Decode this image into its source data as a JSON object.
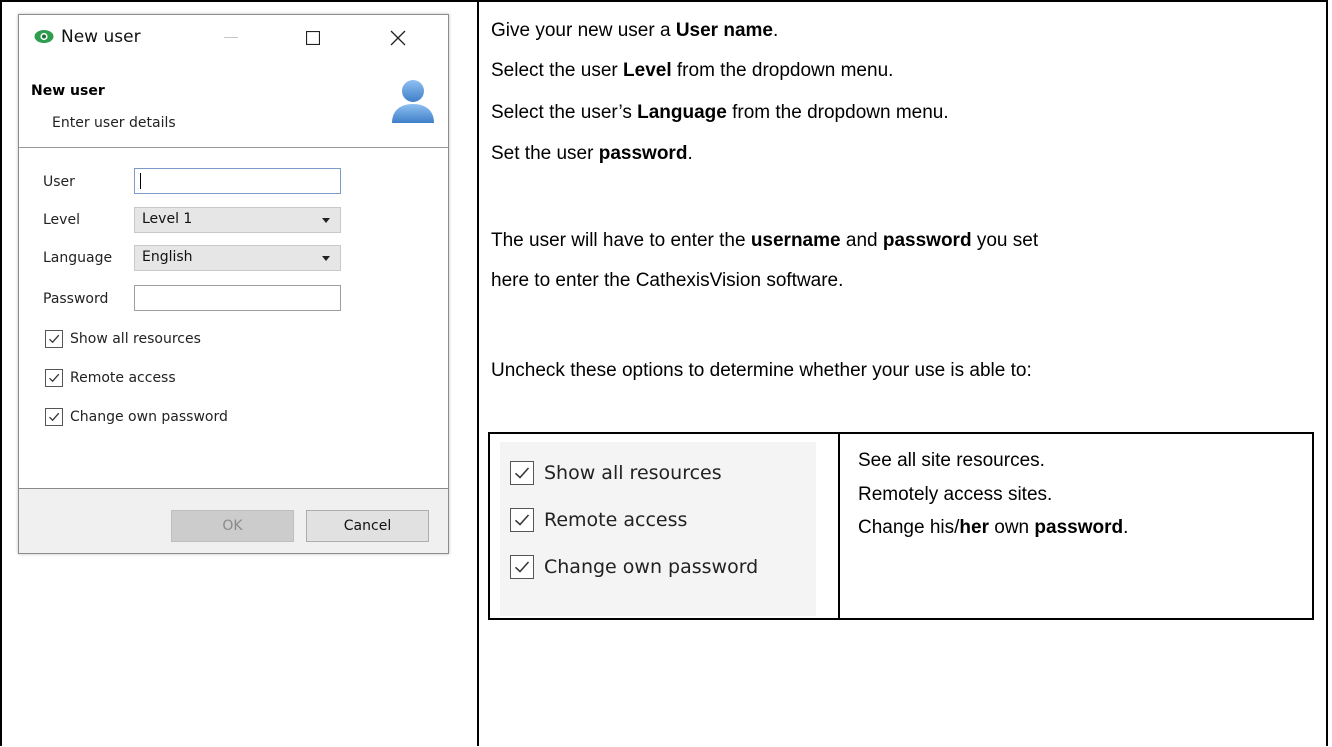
{
  "dialog": {
    "title": "New user",
    "header_title": "New user",
    "header_subtitle": "Enter user details",
    "fields": {
      "user_label": "User",
      "user_value": "",
      "level_label": "Level",
      "level_value": "Level 1",
      "language_label": "Language",
      "language_value": "English",
      "password_label": "Password",
      "password_value": ""
    },
    "checkboxes": [
      {
        "label": "Show all resources",
        "checked": true
      },
      {
        "label": "Remote access",
        "checked": true
      },
      {
        "label": "Change own password",
        "checked": true
      }
    ],
    "buttons": {
      "ok": "OK",
      "cancel": "Cancel"
    }
  },
  "instructions": {
    "line1": {
      "pre": "Give your new user a ",
      "bold": "User name",
      "post": "."
    },
    "line2": {
      "pre": "Select the user ",
      "bold": "Level",
      "post": " from the dropdown menu."
    },
    "line3": {
      "pre": "Select the user’s ",
      "bold": "Language",
      "post": " from the dropdown menu."
    },
    "line4": {
      "pre": "Set the user ",
      "bold": "password",
      "post": "."
    },
    "para2": {
      "pre": "The user will have to enter the ",
      "bold1": "username",
      "mid": " and ",
      "bold2": "password",
      "post1": " you set",
      "line2": "here to enter the CathexisVision software."
    },
    "para3": "Uncheck these options to determine whether your use is able to:"
  },
  "option_table": {
    "checkboxes": [
      "Show all resources",
      "Remote access",
      "Change own password"
    ],
    "descriptions": {
      "d1": "See all site resources.",
      "d2": "Remotely access sites.",
      "d3": {
        "pre": "Change his/",
        "bold1": "her",
        "mid": " own ",
        "bold2": "password",
        "post": "."
      }
    }
  },
  "colors": {
    "accent_blue": "#5b8fd0",
    "app_icon_green": "#2e9d4e"
  }
}
